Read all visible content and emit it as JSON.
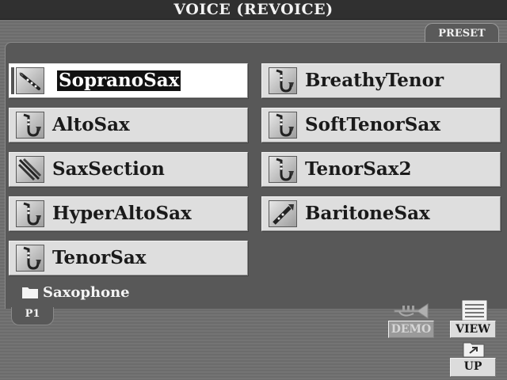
{
  "window": {
    "title": "VOICE (REVOICE)"
  },
  "tabs": {
    "preset": "PRESET"
  },
  "voices": [
    {
      "label": "SopranoSax",
      "icon": "soprano-sax-icon",
      "selected": true
    },
    {
      "label": "AltoSax",
      "icon": "saxophone-icon"
    },
    {
      "label": "SaxSection",
      "icon": "sax-section-icon"
    },
    {
      "label": "HyperAltoSax",
      "icon": "saxophone-icon"
    },
    {
      "label": "TenorSax",
      "icon": "saxophone-icon"
    },
    {
      "label": "BreathyTenor",
      "icon": "saxophone-icon"
    },
    {
      "label": "SoftTenorSax",
      "icon": "saxophone-icon"
    },
    {
      "label": "TenorSax2",
      "icon": "saxophone-icon"
    },
    {
      "label": "BaritoneSax",
      "icon": "baritone-sax-icon"
    }
  ],
  "folder": {
    "name": "Saxophone",
    "icon": "folder-icon"
  },
  "page": {
    "label": "P1"
  },
  "buttons": {
    "demo": "DEMO",
    "view": "VIEW",
    "up": "UP"
  },
  "colors": {
    "selected_bg": "#ffffff",
    "button_bg": "#dedede",
    "panel_bg": "#585858"
  }
}
